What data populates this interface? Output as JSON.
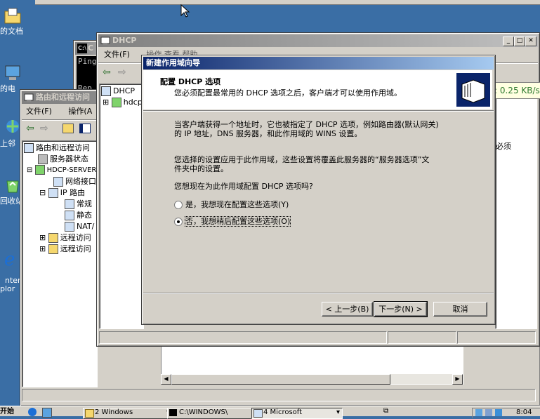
{
  "desktop": {
    "icons": [
      {
        "label": "的文档",
        "icon": "my-documents-icon"
      },
      {
        "label": "的电",
        "icon": "my-computer-icon"
      },
      {
        "label": "上邻",
        "icon": "network-places-icon"
      },
      {
        "label": "回收站",
        "icon": "recycle-bin-icon"
      },
      {
        "label": "ntern\nplor",
        "icon": "internet-explorer-icon"
      }
    ]
  },
  "cmd_window": {
    "title": "C",
    "line1": "Ping",
    "line2": "Rep"
  },
  "routing_window": {
    "title": "路由和远程访问",
    "menu": [
      "文件(F)",
      "操作(A"
    ],
    "tree": [
      "路由和远程访问",
      "服务器状态",
      "HDCP-SERVER",
      "网络接口",
      "IP 路由",
      "常规",
      "静态",
      "NAT/",
      "远程访问",
      "远程访问"
    ]
  },
  "dhcp_window": {
    "title": "DHCP",
    "menu_file": "文件(F)",
    "menu_hidden": "操作   查看   帮助",
    "tree_root": "DHCP",
    "tree_child": "hdcp",
    "right_text": "必须"
  },
  "network_tooltip": {
    "text": "上传: 0.25 KB/s"
  },
  "wizard": {
    "title": "新建作用域向导",
    "header_title": "配置 DHCP 选项",
    "header_subtitle": "您必须配置最常用的 DHCP 选项之后，客户端才可以使用作用域。",
    "para1_line1": "当客户端获得一个地址时，它也被指定了 DHCP 选项，例如路由器(默认网关)",
    "para1_line2": "的 IP 地址，DNS 服务器，和此作用域的 WINS 设置。",
    "para2_line1": "您选择的设置应用于此作用域，这些设置将覆盖此服务器的“服务器选项”文",
    "para2_line2": "件夹中的设置。",
    "question": "您想现在为此作用域配置 DHCP 选项吗?",
    "option_yes": "是，我想现在配置这些选项(Y)",
    "option_no": "否，我想稍后配置这些选项(O)",
    "selected": "no",
    "btn_back": "< 上一步(B)",
    "btn_next": "下一步(N) >",
    "btn_cancel": "取消"
  },
  "taskbar": {
    "start": "开始",
    "tasks": [
      "2 Windows",
      "C:\\WINDOWS\\",
      "4 Microsoft"
    ],
    "clock": "8:04"
  }
}
